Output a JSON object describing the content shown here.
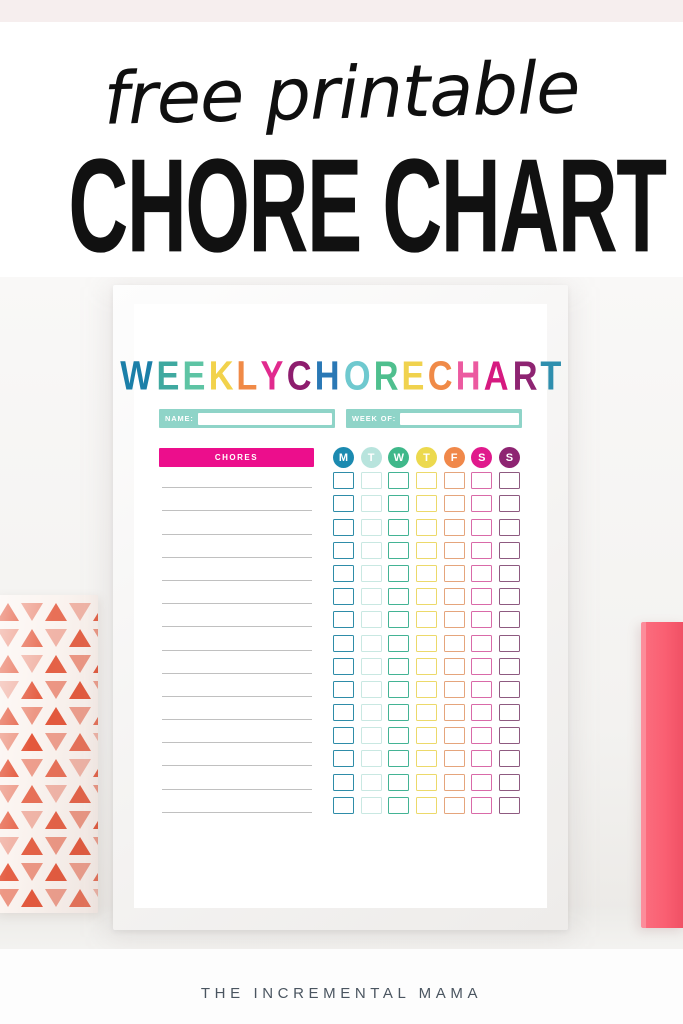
{
  "page": {
    "top_band_color": "#f6eeee"
  },
  "header": {
    "script_line": "free printable",
    "block_line": "CHORE CHART"
  },
  "printable": {
    "title_text": "WEEKLY CHORE CHART",
    "title_letters": [
      {
        "ch": "W",
        "color": "#1b7fa8"
      },
      {
        "ch": "E",
        "color": "#3fa9a0"
      },
      {
        "ch": "E",
        "color": "#5ec4a4"
      },
      {
        "ch": "K",
        "color": "#f2d24b"
      },
      {
        "ch": "L",
        "color": "#f08a47"
      },
      {
        "ch": "Y",
        "color": "#e12a8e"
      },
      {
        "ch": " ",
        "color": ""
      },
      {
        "ch": "C",
        "color": "#8e1d6e"
      },
      {
        "ch": "H",
        "color": "#2a78b5"
      },
      {
        "ch": "O",
        "color": "#6fc9cf"
      },
      {
        "ch": "R",
        "color": "#4fbf8e"
      },
      {
        "ch": "E",
        "color": "#f0d24e"
      },
      {
        "ch": " ",
        "color": ""
      },
      {
        "ch": "C",
        "color": "#f08a47"
      },
      {
        "ch": "H",
        "color": "#ec5aa0"
      },
      {
        "ch": "A",
        "color": "#d61a80"
      },
      {
        "ch": "R",
        "color": "#8e2472"
      },
      {
        "ch": "T",
        "color": "#2f8fae"
      }
    ],
    "fields": [
      {
        "label": "NAME:",
        "value": ""
      },
      {
        "label": "WEEK OF:",
        "value": ""
      }
    ],
    "field_color": "#8fd4c8",
    "chores_header": "CHORES",
    "chores_header_color": "#ec0e8c",
    "days": [
      {
        "letter": "M",
        "name": "Monday",
        "color": "#1b8ab0"
      },
      {
        "letter": "T",
        "name": "Tuesday",
        "color": "#b8e4dd"
      },
      {
        "letter": "W",
        "name": "Wednesday",
        "color": "#3fb88a"
      },
      {
        "letter": "T",
        "name": "Thursday",
        "color": "#ecd94e"
      },
      {
        "letter": "F",
        "name": "Friday",
        "color": "#f0884a"
      },
      {
        "letter": "S",
        "name": "Saturday",
        "color": "#e0198c"
      },
      {
        "letter": "S",
        "name": "Sunday",
        "color": "#8e2472"
      }
    ],
    "checkbox_border_colors": [
      "#2e8ca8",
      "#c9e8e2",
      "#43b394",
      "#ecd96a",
      "#e5a57c",
      "#d96aa8",
      "#8e5a80"
    ],
    "rows": 15,
    "chore_lines": [
      "",
      "",
      "",
      "",
      "",
      "",
      "",
      "",
      "",
      "",
      "",
      "",
      "",
      "",
      ""
    ]
  },
  "decor": {
    "left_box_pattern": "triangles",
    "left_box_color": "#e4583c",
    "right_book_color": "#fa5f72"
  },
  "footer": {
    "brand": "THE INCREMENTAL MAMA"
  }
}
